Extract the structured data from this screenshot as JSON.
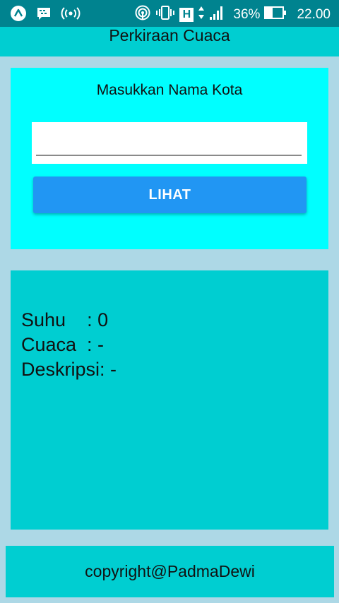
{
  "status_bar": {
    "battery_percent": "36%",
    "time": "22.00",
    "network_type": "H",
    "icons": [
      "launcher-icon",
      "bbm-chat-icon",
      "hotspot-icon",
      "nfc-signal-icon",
      "vibrate-icon",
      "data-arrows-icon",
      "signal-bars-icon",
      "battery-icon"
    ]
  },
  "app_bar": {
    "title": "Perkiraan Cuaca"
  },
  "input_card": {
    "label": "Masukkan Nama Kota",
    "city_value": "",
    "button_label": "LIHAT"
  },
  "result": {
    "suhu": "Suhu    : 0",
    "cuaca": "Cuaca  : -",
    "deskripsi": "Deskripsi: -"
  },
  "footer": {
    "text": "copyright@PadmaDewi"
  },
  "colors": {
    "status_bar": "#00838f",
    "background": "#add8e6",
    "app_bar": "#00ced1",
    "input_card": "#00ffff",
    "button": "#2196f3",
    "result_card": "#00ced1"
  }
}
